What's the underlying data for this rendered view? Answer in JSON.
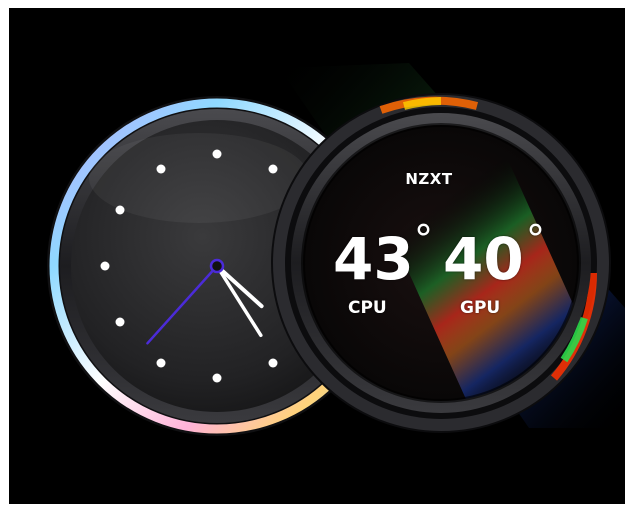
{
  "display": {
    "brand": "NZXT",
    "cpu": {
      "value": "43",
      "unit": "°",
      "label": "CPU"
    },
    "gpu": {
      "value": "40",
      "unit": "°",
      "label": "GPU"
    }
  },
  "clock": {
    "hour_markers": 12,
    "time_shown": {
      "hours": 4,
      "minutes": 24,
      "seconds": 37
    }
  },
  "colors": {
    "background": "#000000",
    "second_hand": "#4b2bd8",
    "hand": "#ffffff",
    "ring": "#2a2a2e"
  },
  "icons": [
    "hour-marker-dot",
    "clock-hands",
    "rainbow-ring"
  ]
}
